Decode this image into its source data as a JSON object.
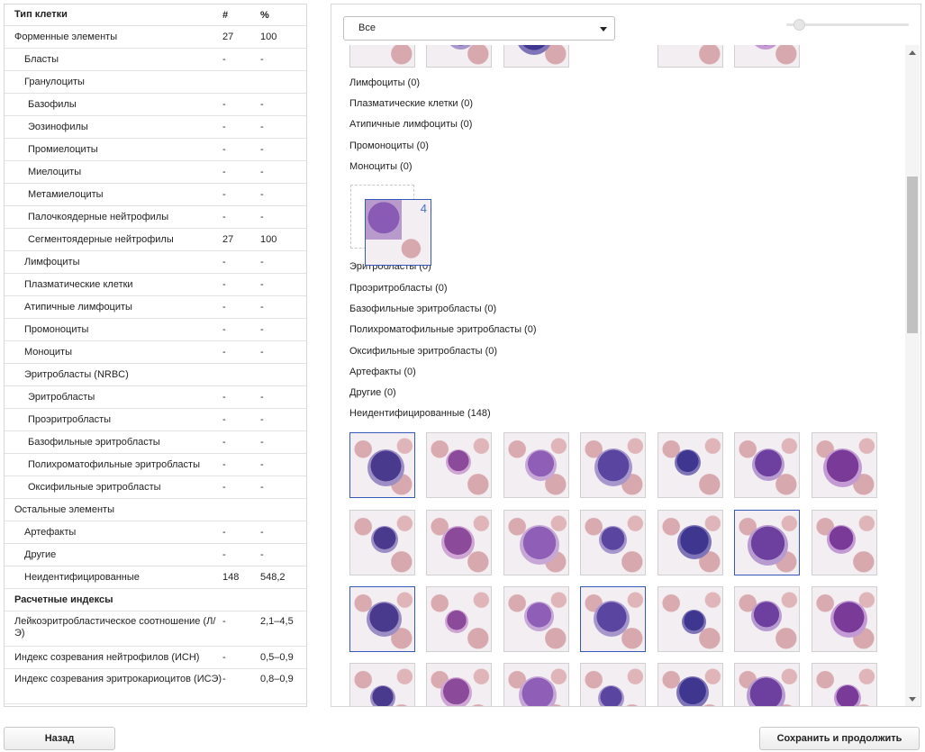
{
  "table": {
    "headers": {
      "name": "Тип клетки",
      "count": "#",
      "percent": "%"
    },
    "rows": [
      {
        "name": "Форменные элементы",
        "count": "27",
        "percent": "100",
        "level": 0
      },
      {
        "name": "Бласты",
        "count": "-",
        "percent": "-",
        "level": 1
      },
      {
        "name": "Гранулоциты",
        "count": "",
        "percent": "",
        "level": 1
      },
      {
        "name": "Базофилы",
        "count": "-",
        "percent": "-",
        "level": 2
      },
      {
        "name": "Эозинофилы",
        "count": "-",
        "percent": "-",
        "level": 2
      },
      {
        "name": "Промиелоциты",
        "count": "-",
        "percent": "-",
        "level": 2
      },
      {
        "name": "Миелоциты",
        "count": "-",
        "percent": "-",
        "level": 2
      },
      {
        "name": "Метамиелоциты",
        "count": "-",
        "percent": "-",
        "level": 2
      },
      {
        "name": "Палочкоядерные нейтрофилы",
        "count": "-",
        "percent": "-",
        "level": 2
      },
      {
        "name": "Сегментоядерные нейтрофилы",
        "count": "27",
        "percent": "100",
        "level": 2
      },
      {
        "name": "Лимфоциты",
        "count": "-",
        "percent": "-",
        "level": 1
      },
      {
        "name": "Плазматические клетки",
        "count": "-",
        "percent": "-",
        "level": 1
      },
      {
        "name": "Атипичные лимфоциты",
        "count": "-",
        "percent": "-",
        "level": 1
      },
      {
        "name": "Промоноциты",
        "count": "-",
        "percent": "-",
        "level": 1
      },
      {
        "name": "Моноциты",
        "count": "-",
        "percent": "-",
        "level": 1
      },
      {
        "name": "Эритробласты (NRBC)",
        "count": "",
        "percent": "",
        "level": 1
      },
      {
        "name": "Эритробласты",
        "count": "-",
        "percent": "-",
        "level": 2
      },
      {
        "name": "Проэритробласты",
        "count": "-",
        "percent": "-",
        "level": 2
      },
      {
        "name": "Базофильные эритробласты",
        "count": "-",
        "percent": "-",
        "level": 2
      },
      {
        "name": "Полихроматофильные эритробласты",
        "count": "-",
        "percent": "-",
        "level": 2
      },
      {
        "name": "Оксифильные эритробласты",
        "count": "-",
        "percent": "-",
        "level": 2
      },
      {
        "name": "Остальные элементы",
        "count": "",
        "percent": "",
        "level": 0
      },
      {
        "name": "Артефакты",
        "count": "-",
        "percent": "-",
        "level": 1
      },
      {
        "name": "Другие",
        "count": "-",
        "percent": "-",
        "level": 1
      },
      {
        "name": "Неидентифицированные",
        "count": "148",
        "percent": "548,2",
        "level": 1
      }
    ],
    "indices_header": "Расчетные индексы",
    "indices": [
      {
        "name": "Лейкоэритробластическое соотношение (Л/Э)",
        "count": "-",
        "percent": "2,1–4,5",
        "tall": true
      },
      {
        "name": "Индекс созревания нейтрофилов (ИСН)",
        "count": "-",
        "percent": "0,5–0,9",
        "tall": false
      },
      {
        "name": "Индекс созревания эритрокариоцитов (ИСЭ)",
        "count": "-",
        "percent": "0,8–0,9",
        "tall": true
      }
    ]
  },
  "gallery": {
    "filter_value": "Все",
    "categories": [
      "Лимфоциты (0)",
      "Плазматические клетки (0)",
      "Атипичные лимфоциты (0)",
      "Промоноциты (0)",
      "Моноциты (0)",
      "Эритробласты (0)",
      "Проэритробласты (0)",
      "Базофильные эритробласты (0)",
      "Полихроматофильные эритробласты (0)",
      "Оксифильные эритробласты (0)",
      "Артефакты (0)",
      "Другие (0)",
      "Неидентифицированные (148)"
    ],
    "drag_count": "4"
  },
  "buttons": {
    "back": "Назад",
    "save": "Сохранить и продолжить"
  }
}
